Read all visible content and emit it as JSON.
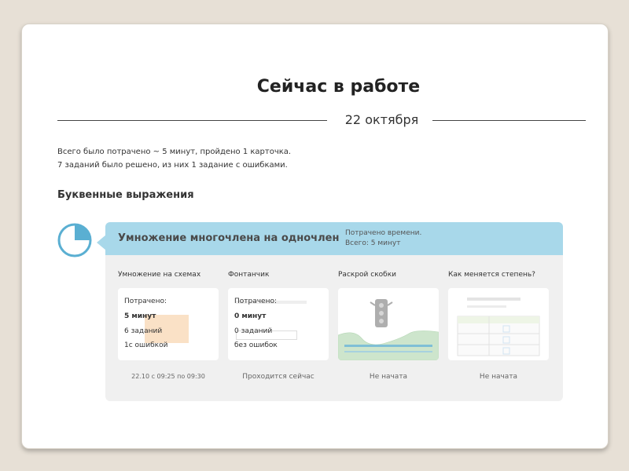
{
  "header": {
    "title": "Сейчас в работе",
    "date": "22 октября"
  },
  "summary": {
    "line1": "Всего было потрачено ~ 5 минут, пройдено 1 карточка.",
    "line2": "7 заданий было решено, из них  1 задание с ошибками."
  },
  "section": {
    "title": "Буквенные выражения"
  },
  "topic_card": {
    "title": "Умножение многочлена на одночлен",
    "time_label": "Потрачено времени.",
    "time_value": "Всего: 5 минут",
    "progress": 0.25,
    "accent": "#a8d8ea",
    "icon_color": "#5aafd2"
  },
  "tasks": [
    {
      "name": "Умножение на схемах",
      "spent_label": "Потрачено:",
      "time": "5 минут",
      "count": "6 заданий",
      "errors": "1с ошибкой",
      "status": "22.10 с 09:25 по 09:30"
    },
    {
      "name": "Фонтанчик",
      "spent_label": "Потрачено:",
      "time": "0 минут",
      "count": "0 заданий",
      "errors": "без ошибок",
      "status": "Проходится сейчас"
    },
    {
      "name": "Раскрой скобки",
      "status": "Не начата"
    },
    {
      "name": "Как меняется степень?",
      "status": "Не начата"
    }
  ]
}
